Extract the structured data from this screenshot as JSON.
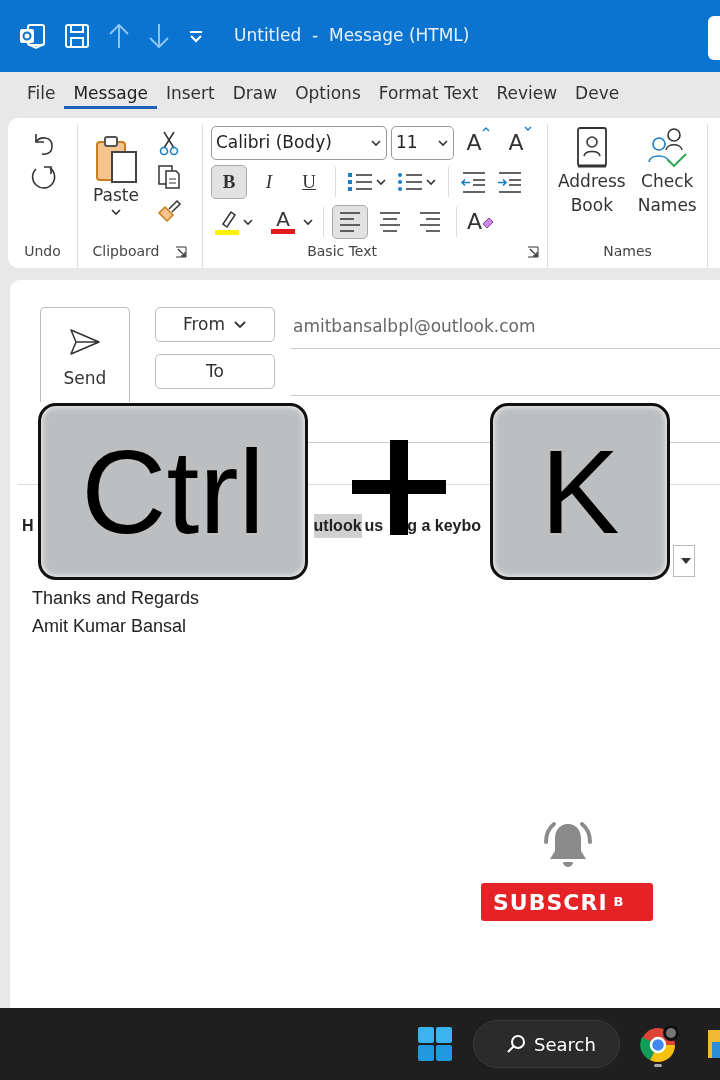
{
  "title_bar": {
    "title": "Untitled  -  Message (HTML)"
  },
  "tabs": [
    {
      "label": "File",
      "selected": false
    },
    {
      "label": "Message",
      "selected": true
    },
    {
      "label": "Insert",
      "selected": false
    },
    {
      "label": "Draw",
      "selected": false
    },
    {
      "label": "Options",
      "selected": false
    },
    {
      "label": "Format Text",
      "selected": false
    },
    {
      "label": "Review",
      "selected": false
    },
    {
      "label": "Deve",
      "selected": false
    }
  ],
  "ribbon": {
    "undo_group": "Undo",
    "clipboard_group": "Clipboard",
    "paste": "Paste",
    "basic_text_group": "Basic Text",
    "font": "Calibri (Body)",
    "size": "11",
    "grow": "A",
    "shrink": "A",
    "styles": [
      {
        "label": "B",
        "selected": true
      },
      {
        "label": "I",
        "selected": false
      },
      {
        "label": "U",
        "selected": false
      }
    ],
    "font_color": "A",
    "clear_format": "A",
    "aligns": [
      {
        "kind": "left",
        "selected": true
      },
      {
        "kind": "center",
        "selected": false
      },
      {
        "kind": "right",
        "selected": false
      }
    ],
    "names_group": "Names",
    "address_book": [
      "Address",
      "Book"
    ],
    "check_names": [
      "Check",
      "Names"
    ]
  },
  "compose": {
    "send": "Send",
    "from_button": "From",
    "from_value": "amitbansalbpl@outlook.com",
    "to_button": "To"
  },
  "body": {
    "line": [
      {
        "text": "H",
        "highlighted": false
      },
      {
        "text": "utlook",
        "highlighted": true
      },
      {
        "text": "us",
        "highlighted": false
      },
      {
        "text": "g a keybo",
        "highlighted": false
      }
    ],
    "signature": [
      "Thanks and Regards",
      "Amit Kumar Bansal"
    ]
  },
  "overlay_keys": [
    {
      "kind": "key",
      "label": "Ctrl"
    },
    {
      "kind": "plus"
    },
    {
      "kind": "key",
      "label": "K"
    }
  ],
  "subscribe": {
    "label": "SUBSCRI",
    "tail": "B"
  },
  "taskbar": {
    "search": "Search"
  }
}
